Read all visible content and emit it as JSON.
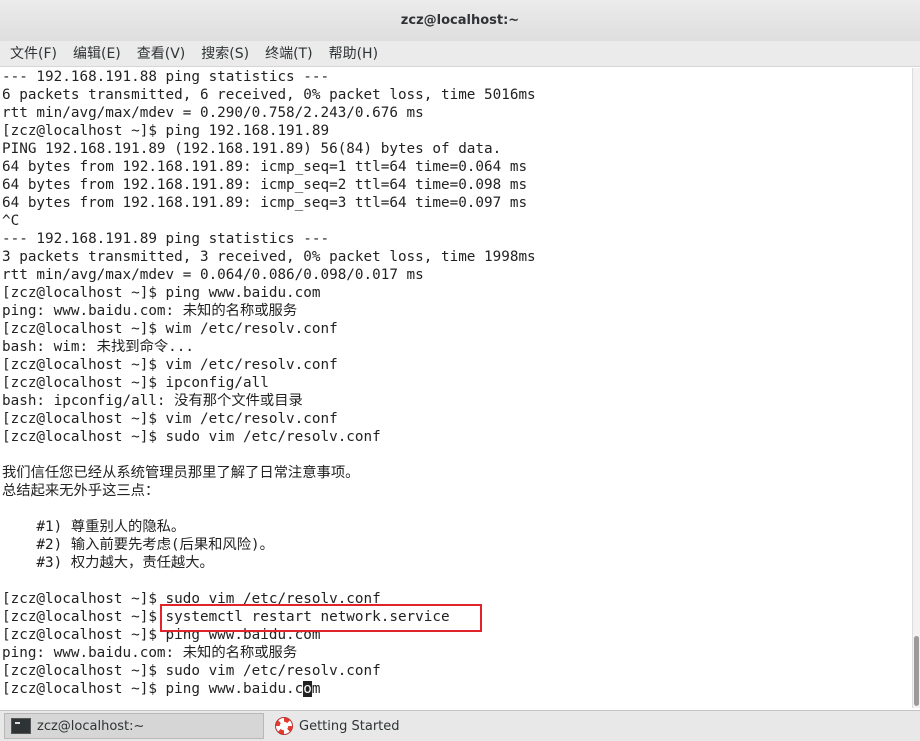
{
  "window": {
    "title": "zcz@localhost:~"
  },
  "menu": [
    "文件(F)",
    "编辑(E)",
    "查看(V)",
    "搜索(S)",
    "终端(T)",
    "帮助(H)"
  ],
  "terminal": {
    "lines": [
      "--- 192.168.191.88 ping statistics ---",
      "6 packets transmitted, 6 received, 0% packet loss, time 5016ms",
      "rtt min/avg/max/mdev = 0.290/0.758/2.243/0.676 ms",
      "[zcz@localhost ~]$ ping 192.168.191.89",
      "PING 192.168.191.89 (192.168.191.89) 56(84) bytes of data.",
      "64 bytes from 192.168.191.89: icmp_seq=1 ttl=64 time=0.064 ms",
      "64 bytes from 192.168.191.89: icmp_seq=2 ttl=64 time=0.098 ms",
      "64 bytes from 192.168.191.89: icmp_seq=3 ttl=64 time=0.097 ms",
      "^C",
      "--- 192.168.191.89 ping statistics ---",
      "3 packets transmitted, 3 received, 0% packet loss, time 1998ms",
      "rtt min/avg/max/mdev = 0.064/0.086/0.098/0.017 ms",
      "[zcz@localhost ~]$ ping www.baidu.com",
      "ping: www.baidu.com: 未知的名称或服务",
      "[zcz@localhost ~]$ wim /etc/resolv.conf",
      "bash: wim: 未找到命令...",
      "[zcz@localhost ~]$ vim /etc/resolv.conf",
      "[zcz@localhost ~]$ ipconfig/all",
      "bash: ipconfig/all: 没有那个文件或目录",
      "[zcz@localhost ~]$ vim /etc/resolv.conf",
      "[zcz@localhost ~]$ sudo vim /etc/resolv.conf",
      "",
      "我们信任您已经从系统管理员那里了解了日常注意事项。",
      "总结起来无外乎这三点：",
      "",
      "    #1) 尊重别人的隐私。",
      "    #2) 输入前要先考虑(后果和风险)。",
      "    #3) 权力越大，责任越大。",
      "",
      "[zcz@localhost ~]$ sudo vim /etc/resolv.conf",
      "[zcz@localhost ~]$ systemctl restart network.service",
      "[zcz@localhost ~]$ ping www.baidu.com",
      "ping: www.baidu.com: 未知的名称或服务",
      "[zcz@localhost ~]$ sudo vim /etc/resolv.conf"
    ],
    "current_prompt": "[zcz@localhost ~]$ ping www.baidu.c",
    "cursor_char": "o",
    "after_cursor": "m"
  },
  "taskbar": {
    "items": [
      {
        "label": "zcz@localhost:~",
        "icon": "terminal-icon"
      },
      {
        "label": "Getting Started",
        "icon": "help-lifebuoy-icon"
      }
    ]
  },
  "colors": {
    "highlight_box": "#e0242a"
  }
}
